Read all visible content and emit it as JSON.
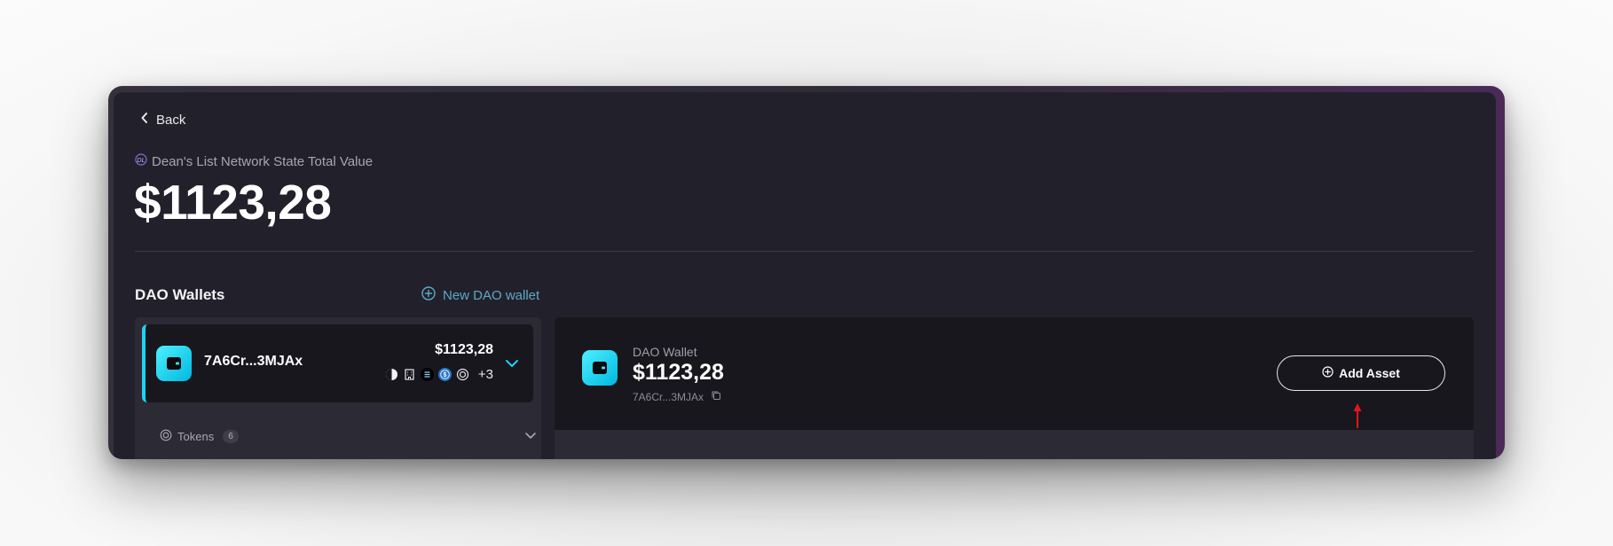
{
  "nav": {
    "back_label": "Back"
  },
  "header": {
    "subtitle": "Dean's List Network State Total Value",
    "logo_text": "DL",
    "total_value": "$1123,28"
  },
  "wallets_section": {
    "title": "DAO Wallets",
    "new_wallet_label": "New DAO wallet"
  },
  "wallet_card": {
    "name": "7A6Cr...3MJAx",
    "value": "$1123,28",
    "asset_icons": [
      "half-circle-token-icon",
      "building-token-icon",
      "stripes-token-icon",
      "usdc-token-icon",
      "ring-token-icon"
    ],
    "more_assets": "+3",
    "accent_color": "#1ed3f3"
  },
  "tokens": {
    "label": "Tokens",
    "count": "6"
  },
  "detail": {
    "label": "DAO Wallet",
    "value": "$1123,28",
    "address": "7A6Cr...3MJAx",
    "add_asset_label": "Add Asset"
  }
}
